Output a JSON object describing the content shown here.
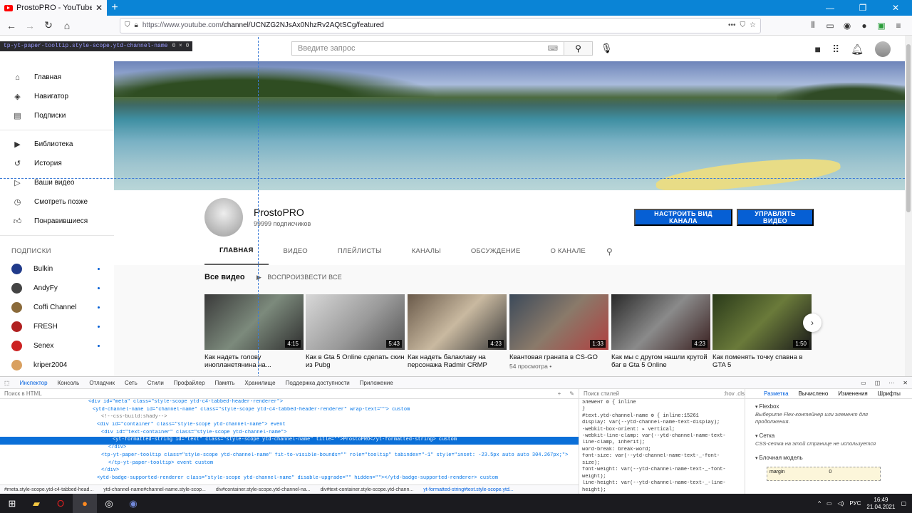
{
  "browser": {
    "tab_title": "ProstoPRO - YouTube",
    "url_prefix": "https://www.youtube.com",
    "url_path": "/channel/UCNZG2NJsAx0NhzRv2AQtSCg/featured"
  },
  "yt": {
    "search_placeholder": "Введите запрос",
    "inspector_tooltip": "tp-yt-paper-tooltip.style-scope.ytd-channel-name",
    "inspector_size": "0 × 0"
  },
  "sidebar": {
    "main": [
      "Главная",
      "Навигатор",
      "Подписки"
    ],
    "library": [
      "Библиотека",
      "История",
      "Ваши видео",
      "Смотреть позже",
      "Понравившиеся"
    ],
    "subs_heading": "ПОДПИСКИ",
    "subs": [
      "Bulkin",
      "AndyFy",
      "Coffi Channel",
      "FRESH",
      "Senex",
      "kriper2004"
    ]
  },
  "channel": {
    "name": "ProstoPRO",
    "subscribers": "99999 подписчиков",
    "btn_customize": "НАСТРОИТЬ ВИД КАНАЛА",
    "btn_manage": "УПРАВЛЯТЬ ВИДЕО",
    "tabs": [
      "ГЛАВНАЯ",
      "ВИДЕО",
      "ПЛЕЙЛИСТЫ",
      "КАНАЛЫ",
      "ОБСУЖДЕНИЕ",
      "О КАНАЛЕ"
    ],
    "section_title": "Все видео",
    "play_all": "ВОСПРОИЗВЕСТИ ВСЕ"
  },
  "videos": [
    {
      "title": "Как надеть голову инопланетянина на...",
      "duration": "4:15",
      "meta": ""
    },
    {
      "title": "Как в Gta 5 Online сделать скин из Pubg",
      "duration": "5:43",
      "meta": ""
    },
    {
      "title": "Как надеть балаклаву на персонажа Radmir CRMP",
      "duration": "4:23",
      "meta": ""
    },
    {
      "title": "Квантовая граната в CS-GO",
      "duration": "1:33",
      "meta": "54 просмотра •"
    },
    {
      "title": "Как мы с другом нашли крутой баг в Gta 5 Online",
      "duration": "4:23",
      "meta": ""
    },
    {
      "title": "Как поменять точку спавна в GTA 5",
      "duration": "1:50",
      "meta": ""
    }
  ],
  "devtools": {
    "tabs": [
      "Инспектор",
      "Консоль",
      "Отладчик",
      "Сеть",
      "Стили",
      "Профайлер",
      "Память",
      "Хранилище",
      "Поддержка доступности",
      "Приложение"
    ],
    "html_search": "Поиск в HTML",
    "html_lines": [
      "<div id=\"meta\" class=\"style-scope ytd-c4-tabbed-header-renderer\">",
      "<ytd-channel-name id=\"channel-name\" class=\"style-scope ytd-c4-tabbed-header-renderer\" wrap-text=\"\"> custom",
      "<!--css-build:shady-->",
      "<div id=\"container\" class=\"style-scope ytd-channel-name\"> event",
      "<div id=\"text-container\" class=\"style-scope ytd-channel-name\">",
      "<yt-formatted-string id=\"text\" class=\"style-scope ytd-channel-name\" title=\"\">ProstoPRO</yt-formatted-string> custom",
      "</div>",
      "<tp-yt-paper-tooltip class=\"style-scope ytd-channel-name\" fit-to-visible-bounds=\"\" role=\"tooltip\" tabindex=\"-1\" style=\"inset: -23.5px auto auto 304.267px;\">",
      "</tp-yt-paper-tooltip> event custom",
      "</div>",
      "<ytd-badge-supported-renderer class=\"style-scope ytd-channel-name\" disable-upgrade=\"\" hidden=\"\"></ytd-badge-supported-renderer> custom"
    ],
    "crumbs": [
      "#meta.style-scope.ytd-c4-tabbed-head...",
      "ytd-channel-name#channel-name.style-scop...",
      "div#container.style-scope.ytd-channel-na...",
      "div#text-container.style-scope.ytd-chann...",
      "yt-formatted-string#text.style-scope.ytd..."
    ],
    "styles_filter": "Поиск стилей",
    "styles_opts": ":hov  .cls",
    "rules": [
      "элемент ⚙ {                          inline",
      "}",
      "#text.ytd-channel-name ⚙ {     inline:15261",
      "  display: var(--ytd-channel-name-text-display);",
      "  -webkit-box-orient: ▸ vertical;",
      "  -webkit-line-clamp: var(--ytd-channel-name-text-",
      "      line-clamp, inherit);",
      "  word-break: break-word;",
      "  font-size: var(--ytd-channel-name-text-_-font-",
      "      size);",
      "  font-weight: var(--ytd-channel-name-text-_-font-",
      "      weight);",
      "  line-height: var(--ytd-channel-name-text-_-line-",
      "      height);"
    ],
    "layout_tabs": [
      "Разметка",
      "Вычислено",
      "Изменения",
      "Шрифты"
    ],
    "flexbox": "Flexbox",
    "flex_note": "Выберите Flex-контейнер или элемент для продолжения.",
    "grid": "Сетка",
    "grid_note": "CSS-сетка на этой странице не используется",
    "boxmodel": "Блочная модель",
    "margin_label": "margin",
    "margin_value": "0"
  },
  "taskbar": {
    "time": "16:49",
    "date": "21.04.2021",
    "lang": "РУС"
  }
}
